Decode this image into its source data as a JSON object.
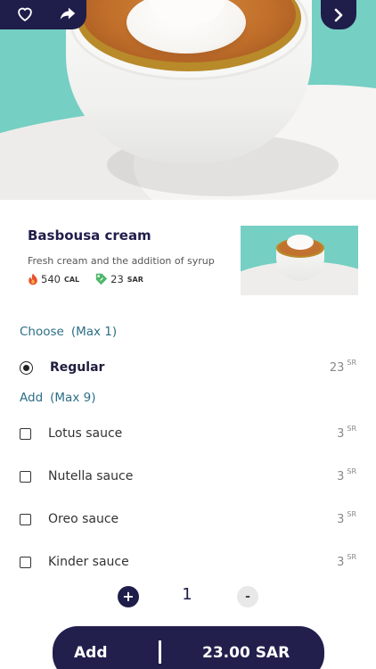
{
  "product": {
    "title": "Basbousa cream",
    "description": "Fresh cream and the addition of syrup",
    "calories_value": "540",
    "calories_unit": "CAL",
    "price_value": "23",
    "price_unit": "SAR"
  },
  "choose": {
    "title": "Choose",
    "max": "(Max 1)",
    "options": [
      {
        "label": "Regular",
        "price": "23",
        "currency": "SR",
        "selected": true
      }
    ]
  },
  "add": {
    "title": "Add",
    "max": "(Max 9)",
    "options": [
      {
        "label": "Lotus sauce",
        "price": "3",
        "currency": "SR",
        "checked": false
      },
      {
        "label": "Nutella sauce",
        "price": "3",
        "currency": "SR",
        "checked": false
      },
      {
        "label": "Oreo sauce",
        "price": "3",
        "currency": "SR",
        "checked": false
      },
      {
        "label": "Kinder sauce",
        "price": "3",
        "currency": "SR",
        "checked": false
      }
    ]
  },
  "quantity": {
    "plus": "+",
    "value": "1",
    "minus": "-"
  },
  "footer": {
    "add_label": "Add",
    "total": "23.00 SAR"
  },
  "icons": {
    "heart": "heart-icon",
    "share": "share-icon",
    "next": "chevron-right-icon",
    "fire": "fire-icon",
    "price_tag": "price-tag-icon"
  },
  "colors": {
    "primary": "#1f1d4a",
    "section_title": "#2c6f86",
    "hero_bg": "#75cfc3"
  }
}
